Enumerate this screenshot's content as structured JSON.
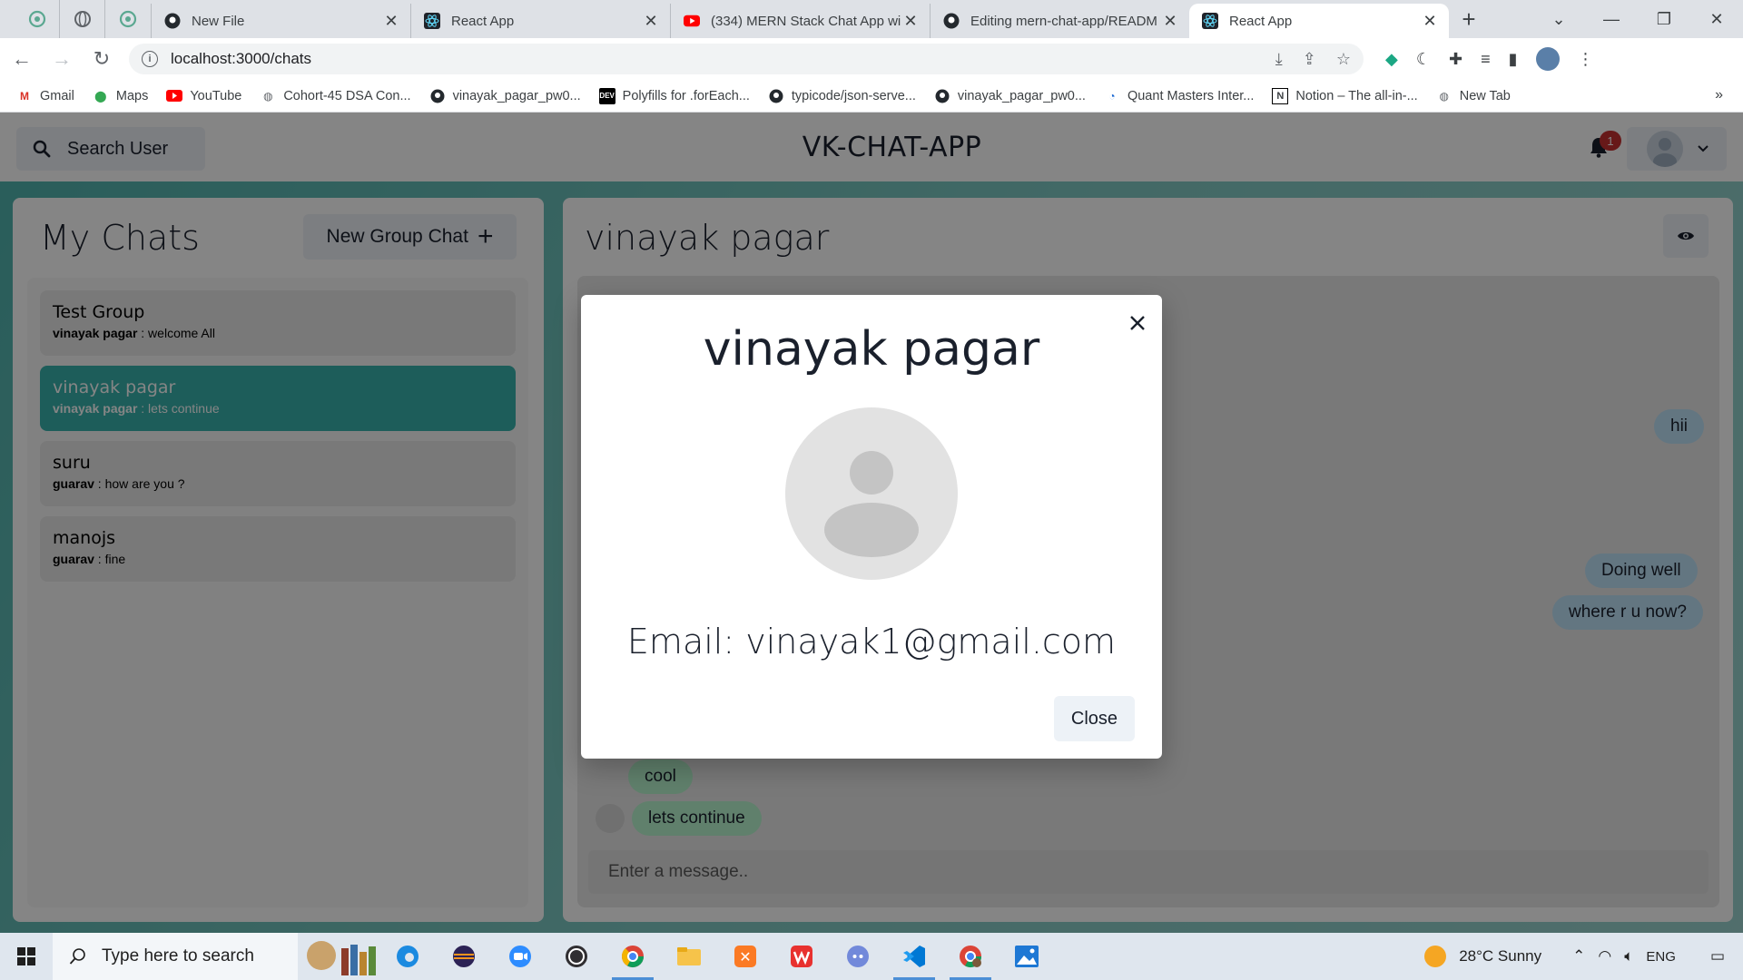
{
  "browser": {
    "tabs": [
      {
        "title": "New File",
        "icon": "github-icon"
      },
      {
        "title": "React App",
        "icon": "react-icon"
      },
      {
        "title": "(334) MERN Stack Chat App wi",
        "icon": "youtube-icon"
      },
      {
        "title": "Editing mern-chat-app/READM",
        "icon": "github-icon"
      },
      {
        "title": "React App",
        "icon": "react-icon",
        "active": true
      }
    ],
    "url": "localhost:3000/chats",
    "bookmarks": [
      {
        "label": "Gmail",
        "icon": "gmail-icon"
      },
      {
        "label": "Maps",
        "icon": "maps-icon"
      },
      {
        "label": "YouTube",
        "icon": "youtube-icon"
      },
      {
        "label": "Cohort-45 DSA Con...",
        "icon": "globe-icon"
      },
      {
        "label": "vinayak_pagar_pw0...",
        "icon": "github-icon"
      },
      {
        "label": "Polyfills for .forEach...",
        "icon": "dev-icon"
      },
      {
        "label": "typicode/json-serve...",
        "icon": "github-icon"
      },
      {
        "label": "vinayak_pagar_pw0...",
        "icon": "github-icon"
      },
      {
        "label": "Quant Masters Inter...",
        "icon": "quant-icon"
      },
      {
        "label": "Notion – The all-in-...",
        "icon": "notion-icon"
      },
      {
        "label": "New Tab",
        "icon": "globe-icon"
      }
    ],
    "bookmarks_more": "»",
    "dev_glyph": "DEV",
    "notion_glyph": "N"
  },
  "app": {
    "search_label": "Search User",
    "brand": "VK-CHAT-APP",
    "notification_count": "1",
    "my_chats_title": "My Chats",
    "new_group_label": "New Group Chat",
    "new_group_plus": "+",
    "chats": [
      {
        "name": "Test Group",
        "sender": "vinayak pagar",
        "message": " : welcome All",
        "active": false
      },
      {
        "name": "vinayak pagar",
        "sender": "vinayak pagar",
        "message": " : lets continue",
        "active": true
      },
      {
        "name": "suru",
        "sender": "guarav",
        "message": " : how are you ?",
        "active": false
      },
      {
        "name": "manojs",
        "sender": "guarav",
        "message": " : fine",
        "active": false
      }
    ],
    "chat_title": "vinayak pagar",
    "messages": {
      "m1": "hii",
      "m2": "Doing well",
      "m3": "where r u now?",
      "m4": "cool",
      "m5": "lets continue"
    },
    "input_placeholder": "Enter a message.."
  },
  "modal": {
    "title": "vinayak pagar",
    "email": "Email: vinayak1@gmail.com",
    "close_label": "Close"
  },
  "taskbar": {
    "search_placeholder": "Type here to search",
    "weather": "28°C  Sunny",
    "lang": "ENG"
  },
  "colors": {
    "accent_teal": "#38b2ac",
    "badge_red": "#c53030",
    "my_bubble": "#bee3f8",
    "their_bubble": "#b9f5d0"
  }
}
